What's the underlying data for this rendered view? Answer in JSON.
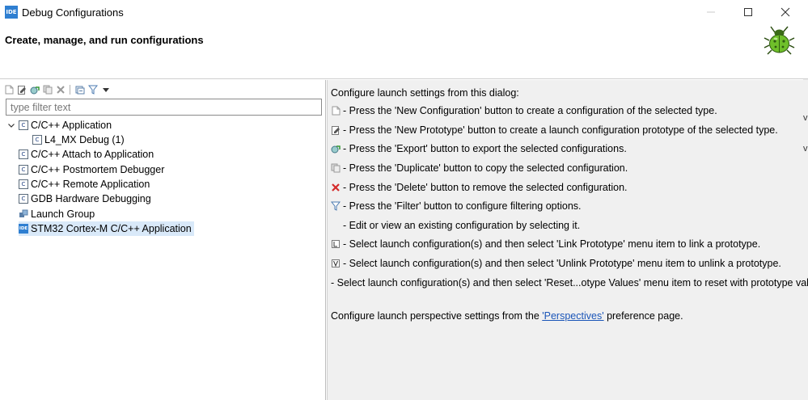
{
  "window": {
    "app_icon_text": "IDE",
    "title": "Debug Configurations",
    "minimize_label": "—",
    "maximize_label": "☐",
    "close_label": "✕"
  },
  "header": {
    "title": "Create, manage, and run configurations",
    "icon": "bug-icon"
  },
  "toolbar": {
    "buttons": [
      "new-configuration-icon",
      "new-prototype-icon",
      "export-icon",
      "duplicate-icon",
      "delete-icon",
      "collapse-all-icon",
      "filter-icon",
      "view-menu-icon"
    ]
  },
  "filter": {
    "placeholder": "type filter text",
    "value": ""
  },
  "tree": {
    "items": [
      {
        "label": "C/C++ Application",
        "expanded": true,
        "icon": "c-app-icon",
        "level": 0
      },
      {
        "label": "L4_MX Debug (1)",
        "icon": "c-config-icon",
        "level": 1
      },
      {
        "label": "C/C++ Attach to Application",
        "icon": "c-attach-icon",
        "level": 0
      },
      {
        "label": "C/C++ Postmortem Debugger",
        "icon": "c-postmortem-icon",
        "level": 0
      },
      {
        "label": "C/C++ Remote Application",
        "icon": "c-remote-icon",
        "level": 0
      },
      {
        "label": "GDB Hardware Debugging",
        "icon": "c-gdb-icon",
        "level": 0
      },
      {
        "label": "Launch Group",
        "icon": "launch-group-icon",
        "level": 0
      },
      {
        "label": "STM32 Cortex-M C/C++ Application",
        "icon": "stm32-icon",
        "level": 0,
        "selected": true
      }
    ],
    "c_icon_text": "C",
    "ide_icon_text": "IDE"
  },
  "info": {
    "intro": "Configure launch settings from this dialog:",
    "lines": [
      {
        "icon": "new-configuration-icon",
        "text": "- Press the 'New Configuration' button to create a configuration of the selected type."
      },
      {
        "icon": "new-prototype-icon",
        "text": "- Press the 'New Prototype' button to create a launch configuration prototype of the selected type."
      },
      {
        "icon": "export-icon",
        "text": "- Press the 'Export' button to export the selected configurations."
      },
      {
        "icon": "duplicate-icon",
        "text": "- Press the 'Duplicate' button to copy the selected configuration."
      },
      {
        "icon": "delete-icon",
        "text": "- Press the 'Delete' button to remove the selected configuration."
      },
      {
        "icon": "filter-icon",
        "text": "- Press the 'Filter' button to configure filtering options."
      },
      {
        "icon": "",
        "text": "- Edit or view an existing configuration by selecting it."
      },
      {
        "icon": "link-prototype-icon",
        "text": "- Select launch configuration(s) and then select 'Link Prototype' menu item to link a prototype."
      },
      {
        "icon": "unlink-prototype-icon",
        "text": "- Select launch configuration(s) and then select 'Unlink Prototype' menu item to unlink a prototype."
      },
      {
        "icon": "",
        "text": "- Select launch configuration(s) and then select 'Reset...otype Values' menu item to reset with prototype values."
      }
    ],
    "perspective_prefix": "Configure launch perspective settings from the ",
    "perspective_link": "'Perspectives'",
    "perspective_suffix": " preference page."
  },
  "edge_marks": [
    "v",
    "v"
  ]
}
